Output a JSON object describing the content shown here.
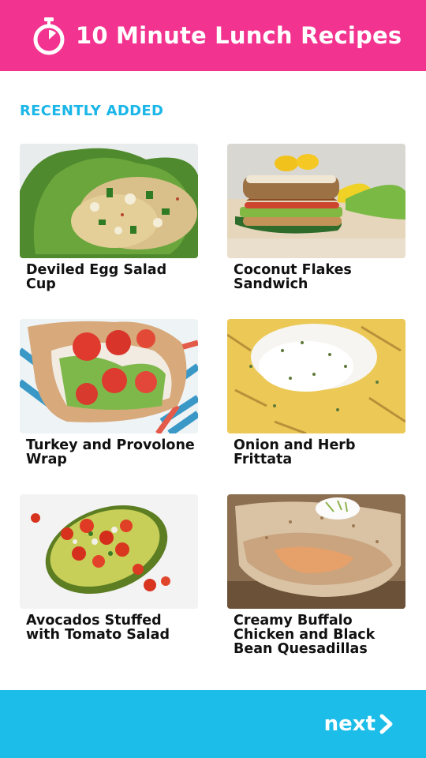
{
  "header": {
    "title": "10 Minute Lunch Recipes",
    "icon": "stopwatch-icon",
    "color": "#f2338f"
  },
  "section": {
    "title": "RECENTLY ADDED",
    "color": "#1ab6e8"
  },
  "recipes": [
    {
      "title": "Deviled Egg Salad Cup",
      "image": "egg-salad-lettuce-photo"
    },
    {
      "title": "Coconut Flakes Sandwich",
      "image": "sandwich-photo"
    },
    {
      "title": "Turkey and Provolone Wrap",
      "image": "turkey-wrap-photo"
    },
    {
      "title": "Onion and Herb Frittata",
      "image": "frittata-photo"
    },
    {
      "title": "Avocados Stuffed with Tomato Salad",
      "image": "stuffed-avocado-photo"
    },
    {
      "title": "Creamy Buffalo Chicken and Black Bean Quesadillas",
      "image": "quesadilla-photo"
    }
  ],
  "footer": {
    "next_label": "next",
    "icon": "chevron-right-icon",
    "color": "#1cbde9"
  }
}
